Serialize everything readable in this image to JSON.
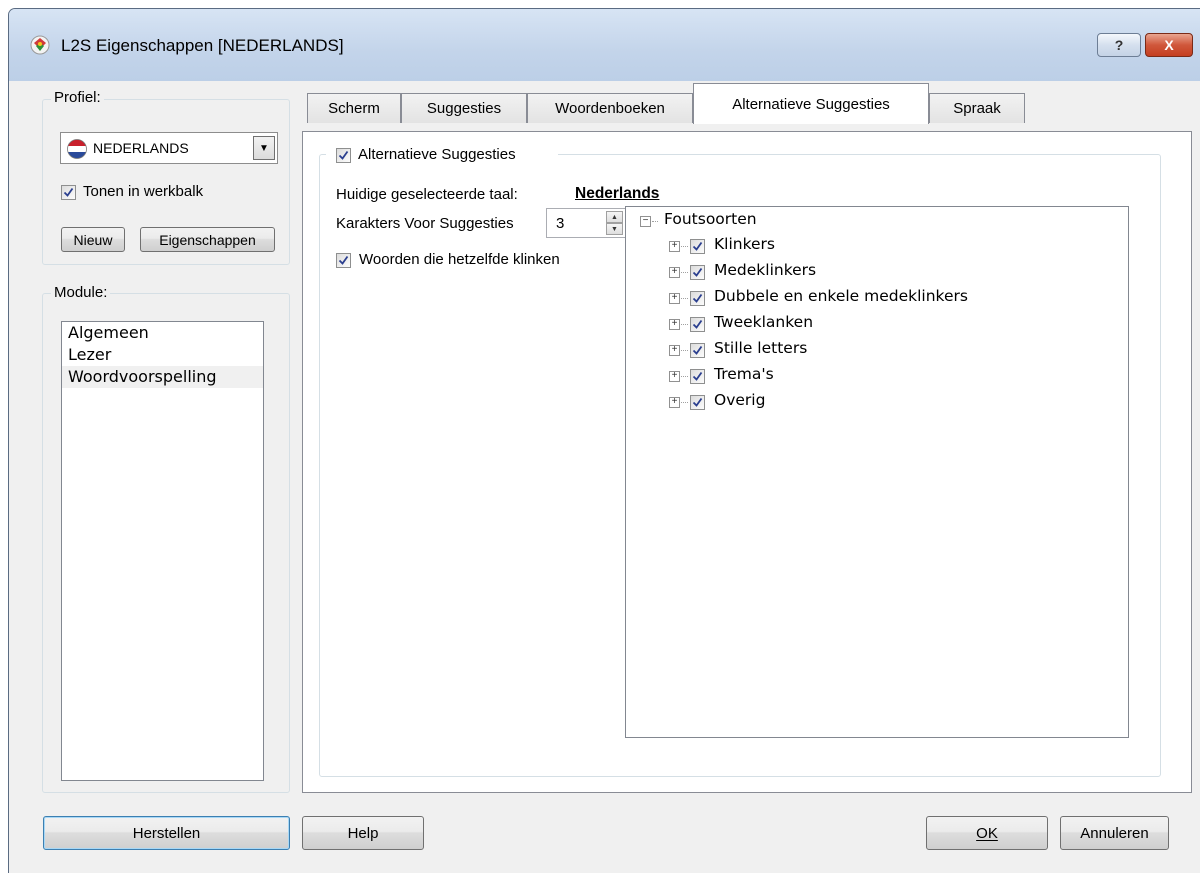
{
  "window": {
    "title": "L2S Eigenschappen [NEDERLANDS]",
    "help_glyph": "?",
    "close_glyph": "X"
  },
  "profile": {
    "group_label": "Profiel:",
    "selected": "NEDERLANDS",
    "show_in_toolbar_label": "Tonen in werkbalk",
    "show_in_toolbar_checked": true,
    "new_button": "Nieuw",
    "properties_button": "Eigenschappen"
  },
  "module": {
    "group_label": "Module:",
    "items": [
      {
        "label": "Algemeen",
        "selected": false
      },
      {
        "label": "Lezer",
        "selected": false
      },
      {
        "label": "Woordvoorspelling",
        "selected": true
      }
    ]
  },
  "tabs": [
    {
      "label": "Scherm",
      "active": false
    },
    {
      "label": "Suggesties",
      "active": false
    },
    {
      "label": "Woordenboeken",
      "active": false
    },
    {
      "label": "Alternatieve Suggesties",
      "active": true
    },
    {
      "label": "Spraak",
      "active": false
    }
  ],
  "panel": {
    "group_checkbox_label": "Alternatieve Suggesties",
    "group_checked": true,
    "current_language_label": "Huidige geselecteerde taal:",
    "current_language": "Nederlands",
    "chars_label": "Karakters Voor Suggesties",
    "chars_value": "3",
    "sound_alike_label": "Woorden die hetzelfde klinken",
    "sound_alike_checked": true,
    "tree": {
      "root": "Foutsoorten",
      "children": [
        {
          "label": "Klinkers",
          "checked": true
        },
        {
          "label": "Medeklinkers",
          "checked": true
        },
        {
          "label": "Dubbele en enkele medeklinkers",
          "checked": true
        },
        {
          "label": "Tweeklanken",
          "checked": true
        },
        {
          "label": "Stille letters",
          "checked": true
        },
        {
          "label": "Trema's",
          "checked": true
        },
        {
          "label": "Overig",
          "checked": true
        }
      ]
    }
  },
  "footer": {
    "restore_button": "Herstellen",
    "help_button": "Help",
    "ok_button": "OK",
    "cancel_button": "Annuleren"
  }
}
